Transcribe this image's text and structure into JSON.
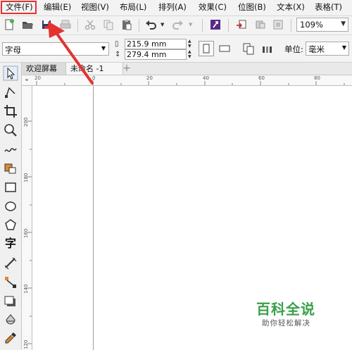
{
  "menubar": {
    "items": [
      "文件(F)",
      "编辑(E)",
      "视图(V)",
      "布局(L)",
      "排列(A)",
      "效果(C)",
      "位图(B)",
      "文本(X)",
      "表格(T)"
    ]
  },
  "toolbar": {
    "zoom": "109%"
  },
  "propbar": {
    "page_preset": "字母",
    "width": "215.9 mm",
    "height": "279.4 mm",
    "unit_label": "单位:",
    "unit": "毫米"
  },
  "tabs": [
    "欢迎屏幕",
    "未命名 -1"
  ],
  "ruler": {
    "horizontal": [
      "20",
      "0",
      "20",
      "40",
      "60",
      "80"
    ],
    "vertical": [
      "200",
      "180",
      "160",
      "140",
      "120"
    ]
  },
  "watermark": {
    "title": "百科全说",
    "subtitle": "助你轻松解决"
  },
  "colors": {
    "highlight": "#e4322f",
    "watermark": "#3aa04a"
  }
}
